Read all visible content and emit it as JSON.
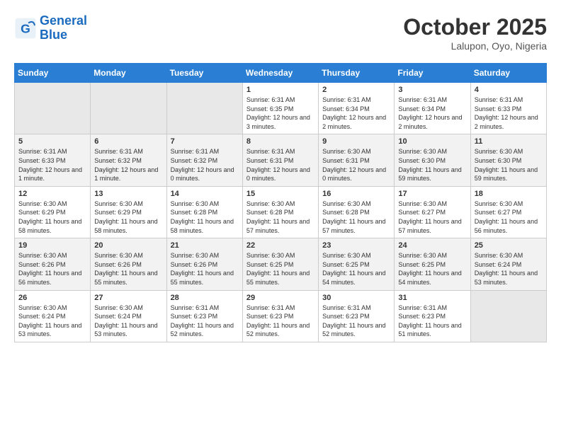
{
  "header": {
    "logo_line1": "General",
    "logo_line2": "Blue",
    "month": "October 2025",
    "location": "Lalupon, Oyo, Nigeria"
  },
  "weekdays": [
    "Sunday",
    "Monday",
    "Tuesday",
    "Wednesday",
    "Thursday",
    "Friday",
    "Saturday"
  ],
  "weeks": [
    [
      {
        "day": "",
        "info": ""
      },
      {
        "day": "",
        "info": ""
      },
      {
        "day": "",
        "info": ""
      },
      {
        "day": "1",
        "info": "Sunrise: 6:31 AM\nSunset: 6:35 PM\nDaylight: 12 hours and 3 minutes."
      },
      {
        "day": "2",
        "info": "Sunrise: 6:31 AM\nSunset: 6:34 PM\nDaylight: 12 hours and 2 minutes."
      },
      {
        "day": "3",
        "info": "Sunrise: 6:31 AM\nSunset: 6:34 PM\nDaylight: 12 hours and 2 minutes."
      },
      {
        "day": "4",
        "info": "Sunrise: 6:31 AM\nSunset: 6:33 PM\nDaylight: 12 hours and 2 minutes."
      }
    ],
    [
      {
        "day": "5",
        "info": "Sunrise: 6:31 AM\nSunset: 6:33 PM\nDaylight: 12 hours and 1 minute."
      },
      {
        "day": "6",
        "info": "Sunrise: 6:31 AM\nSunset: 6:32 PM\nDaylight: 12 hours and 1 minute."
      },
      {
        "day": "7",
        "info": "Sunrise: 6:31 AM\nSunset: 6:32 PM\nDaylight: 12 hours and 0 minutes."
      },
      {
        "day": "8",
        "info": "Sunrise: 6:31 AM\nSunset: 6:31 PM\nDaylight: 12 hours and 0 minutes."
      },
      {
        "day": "9",
        "info": "Sunrise: 6:30 AM\nSunset: 6:31 PM\nDaylight: 12 hours and 0 minutes."
      },
      {
        "day": "10",
        "info": "Sunrise: 6:30 AM\nSunset: 6:30 PM\nDaylight: 11 hours and 59 minutes."
      },
      {
        "day": "11",
        "info": "Sunrise: 6:30 AM\nSunset: 6:30 PM\nDaylight: 11 hours and 59 minutes."
      }
    ],
    [
      {
        "day": "12",
        "info": "Sunrise: 6:30 AM\nSunset: 6:29 PM\nDaylight: 11 hours and 58 minutes."
      },
      {
        "day": "13",
        "info": "Sunrise: 6:30 AM\nSunset: 6:29 PM\nDaylight: 11 hours and 58 minutes."
      },
      {
        "day": "14",
        "info": "Sunrise: 6:30 AM\nSunset: 6:28 PM\nDaylight: 11 hours and 58 minutes."
      },
      {
        "day": "15",
        "info": "Sunrise: 6:30 AM\nSunset: 6:28 PM\nDaylight: 11 hours and 57 minutes."
      },
      {
        "day": "16",
        "info": "Sunrise: 6:30 AM\nSunset: 6:28 PM\nDaylight: 11 hours and 57 minutes."
      },
      {
        "day": "17",
        "info": "Sunrise: 6:30 AM\nSunset: 6:27 PM\nDaylight: 11 hours and 57 minutes."
      },
      {
        "day": "18",
        "info": "Sunrise: 6:30 AM\nSunset: 6:27 PM\nDaylight: 11 hours and 56 minutes."
      }
    ],
    [
      {
        "day": "19",
        "info": "Sunrise: 6:30 AM\nSunset: 6:26 PM\nDaylight: 11 hours and 56 minutes."
      },
      {
        "day": "20",
        "info": "Sunrise: 6:30 AM\nSunset: 6:26 PM\nDaylight: 11 hours and 55 minutes."
      },
      {
        "day": "21",
        "info": "Sunrise: 6:30 AM\nSunset: 6:26 PM\nDaylight: 11 hours and 55 minutes."
      },
      {
        "day": "22",
        "info": "Sunrise: 6:30 AM\nSunset: 6:25 PM\nDaylight: 11 hours and 55 minutes."
      },
      {
        "day": "23",
        "info": "Sunrise: 6:30 AM\nSunset: 6:25 PM\nDaylight: 11 hours and 54 minutes."
      },
      {
        "day": "24",
        "info": "Sunrise: 6:30 AM\nSunset: 6:25 PM\nDaylight: 11 hours and 54 minutes."
      },
      {
        "day": "25",
        "info": "Sunrise: 6:30 AM\nSunset: 6:24 PM\nDaylight: 11 hours and 53 minutes."
      }
    ],
    [
      {
        "day": "26",
        "info": "Sunrise: 6:30 AM\nSunset: 6:24 PM\nDaylight: 11 hours and 53 minutes."
      },
      {
        "day": "27",
        "info": "Sunrise: 6:30 AM\nSunset: 6:24 PM\nDaylight: 11 hours and 53 minutes."
      },
      {
        "day": "28",
        "info": "Sunrise: 6:31 AM\nSunset: 6:23 PM\nDaylight: 11 hours and 52 minutes."
      },
      {
        "day": "29",
        "info": "Sunrise: 6:31 AM\nSunset: 6:23 PM\nDaylight: 11 hours and 52 minutes."
      },
      {
        "day": "30",
        "info": "Sunrise: 6:31 AM\nSunset: 6:23 PM\nDaylight: 11 hours and 52 minutes."
      },
      {
        "day": "31",
        "info": "Sunrise: 6:31 AM\nSunset: 6:23 PM\nDaylight: 11 hours and 51 minutes."
      },
      {
        "day": "",
        "info": ""
      }
    ]
  ]
}
